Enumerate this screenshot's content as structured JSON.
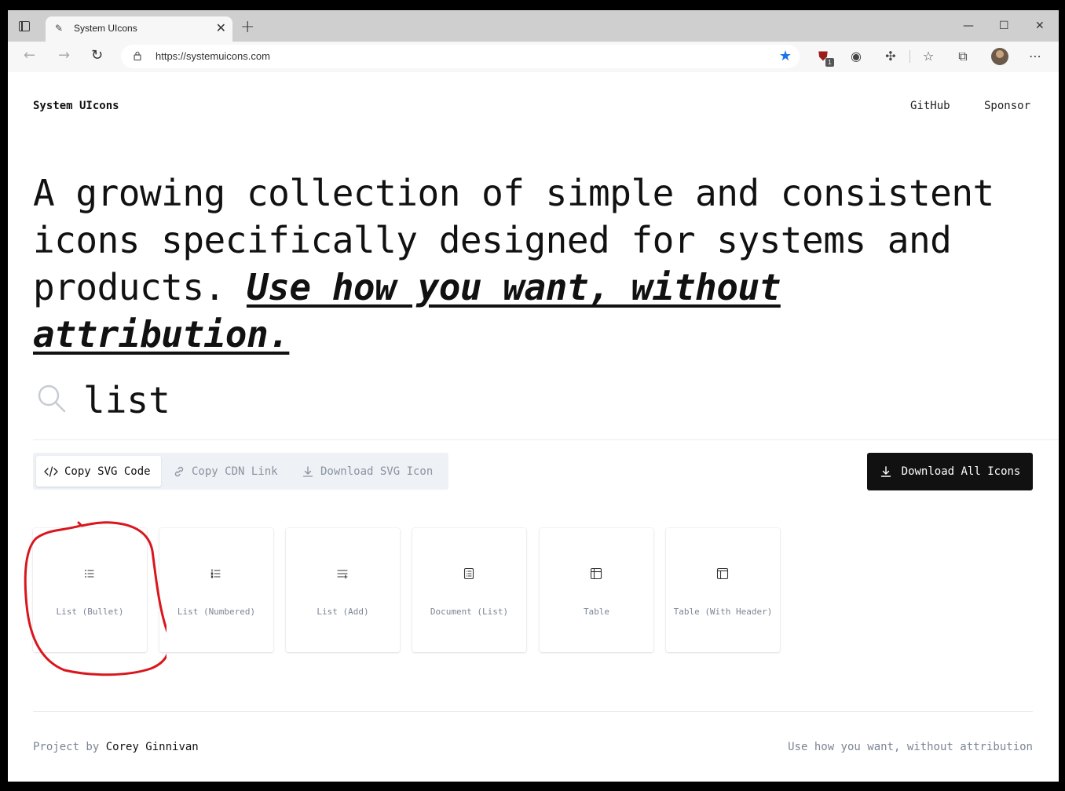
{
  "browser": {
    "tab_title": "System UIcons",
    "url": "https://systemuicons.com",
    "extension_badge": "1"
  },
  "site": {
    "brand": "System UIcons",
    "nav": [
      "GitHub",
      "Sponsor"
    ]
  },
  "hero": {
    "text": "A growing collection of simple and consistent icons specifically designed for systems and products.",
    "emphasis": "Use how you want, without attribution."
  },
  "search": {
    "value": "list"
  },
  "actions": {
    "copy_svg": "Copy SVG Code",
    "copy_cdn": "Copy CDN Link",
    "download_svg": "Download SVG Icon",
    "download_all": "Download All Icons"
  },
  "icons": [
    {
      "label": "List (Bullet)",
      "icon": "list-bullet-icon"
    },
    {
      "label": "List (Numbered)",
      "icon": "list-numbered-icon"
    },
    {
      "label": "List (Add)",
      "icon": "list-add-icon"
    },
    {
      "label": "Document (List)",
      "icon": "document-list-icon"
    },
    {
      "label": "Table",
      "icon": "table-icon"
    },
    {
      "label": "Table (With Header)",
      "icon": "table-header-icon"
    }
  ],
  "footer": {
    "prefix": "Project by",
    "author": "Corey Ginnivan",
    "right": "Use how you want, without attribution"
  },
  "colors": {
    "annotation": "#d9161c",
    "accent_star": "#1a73e8",
    "button_dark": "#111111"
  }
}
